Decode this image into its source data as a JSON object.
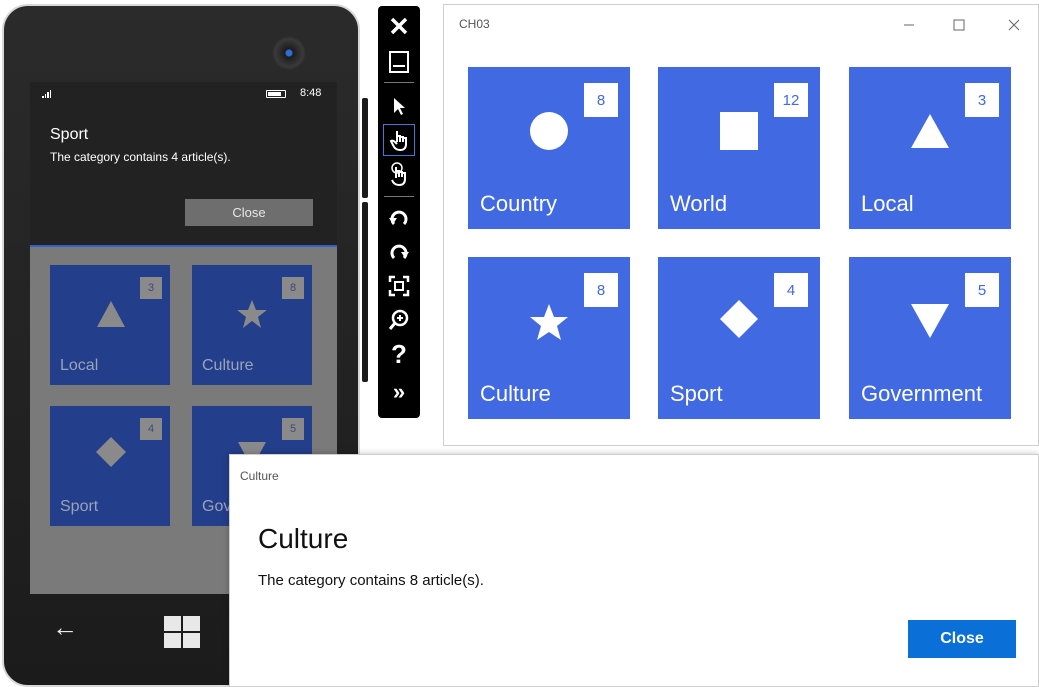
{
  "phone": {
    "clock": "8:48",
    "dialog": {
      "title": "Sport",
      "message": "The category contains 4 article(s).",
      "close_label": "Close"
    },
    "tiles": [
      {
        "label": "Local",
        "count": "3",
        "shape": "triangle-up-icon"
      },
      {
        "label": "Culture",
        "count": "8",
        "shape": "star-icon"
      },
      {
        "label": "Sport",
        "count": "4",
        "shape": "diamond-icon"
      },
      {
        "label": "Gov",
        "count": "5",
        "shape": "triangle-down-icon"
      }
    ]
  },
  "toolbar": {
    "items": [
      "close-icon",
      "minimize-icon",
      "pointer-icon",
      "touch-icon",
      "pinch-icon",
      "rotate-left-icon",
      "rotate-right-icon",
      "fit-screen-icon",
      "zoom-icon",
      "help-icon",
      "more-icon"
    ]
  },
  "window": {
    "title": "CH03",
    "tiles": [
      {
        "label": "Country",
        "count": "8",
        "shape": "circle-icon"
      },
      {
        "label": "World",
        "count": "12",
        "shape": "square-icon"
      },
      {
        "label": "Local",
        "count": "3",
        "shape": "triangle-up-icon"
      },
      {
        "label": "Culture",
        "count": "8",
        "shape": "star-icon"
      },
      {
        "label": "Sport",
        "count": "4",
        "shape": "diamond-icon"
      },
      {
        "label": "Government",
        "count": "5",
        "shape": "triangle-down-icon"
      }
    ]
  },
  "dialog": {
    "caption": "Culture",
    "title": "Culture",
    "message": "The category contains 8 article(s).",
    "close_label": "Close"
  },
  "colors": {
    "tile_blue": "#4169e1",
    "phone_tile_blue": "#233e8a",
    "accent_button": "#0a6fd6"
  }
}
